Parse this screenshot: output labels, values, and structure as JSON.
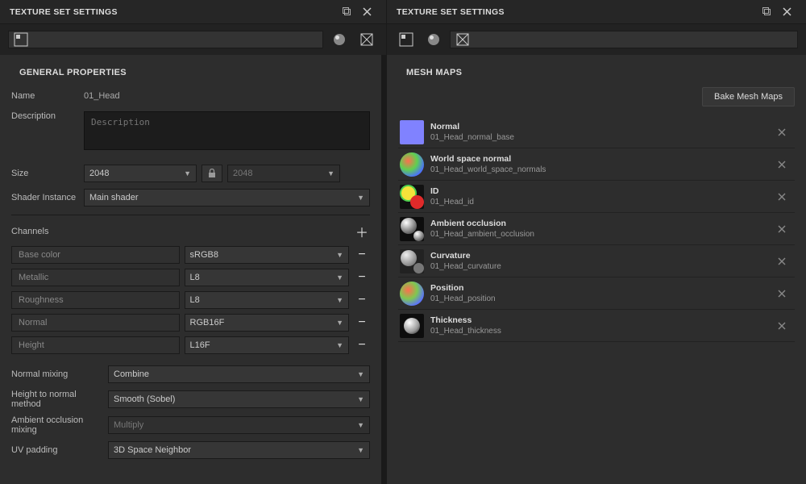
{
  "leftPanel": {
    "title": "TEXTURE SET SETTINGS",
    "section": "GENERAL PROPERTIES",
    "name_lbl": "Name",
    "name_val": "01_Head",
    "desc_lbl": "Description",
    "desc_ph": "Description",
    "size_lbl": "Size",
    "size_a": "2048",
    "size_b": "2048",
    "shader_lbl": "Shader Instance",
    "shader_val": "Main shader",
    "channels_lbl": "Channels",
    "channels": [
      {
        "name": "Base color",
        "fmt": "sRGB8"
      },
      {
        "name": "Metallic",
        "fmt": "L8"
      },
      {
        "name": "Roughness",
        "fmt": "L8"
      },
      {
        "name": "Normal",
        "fmt": "RGB16F"
      },
      {
        "name": "Height",
        "fmt": "L16F"
      }
    ],
    "nm_lbl": "Normal mixing",
    "nm_val": "Combine",
    "h2n_lbl": "Height to normal method",
    "h2n_val": "Smooth (Sobel)",
    "ao_lbl": "Ambient occlusion mixing",
    "ao_val": "Multiply",
    "uv_lbl": "UV padding",
    "uv_val": "3D Space Neighbor"
  },
  "rightPanel": {
    "title": "TEXTURE SET SETTINGS",
    "section": "MESH MAPS",
    "bake_btn": "Bake Mesh Maps",
    "maps": [
      {
        "name": "Normal",
        "file": "01_Head_normal_base",
        "t": "normal"
      },
      {
        "name": "World space normal",
        "file": "01_Head_world_space_normals",
        "t": "world"
      },
      {
        "name": "ID",
        "file": "01_Head_id",
        "t": "id"
      },
      {
        "name": "Ambient occlusion",
        "file": "01_Head_ambient_occlusion",
        "t": "ao"
      },
      {
        "name": "Curvature",
        "file": "01_Head_curvature",
        "t": "cur"
      },
      {
        "name": "Position",
        "file": "01_Head_position",
        "t": "pos"
      },
      {
        "name": "Thickness",
        "file": "01_Head_thickness",
        "t": "thk"
      }
    ]
  }
}
